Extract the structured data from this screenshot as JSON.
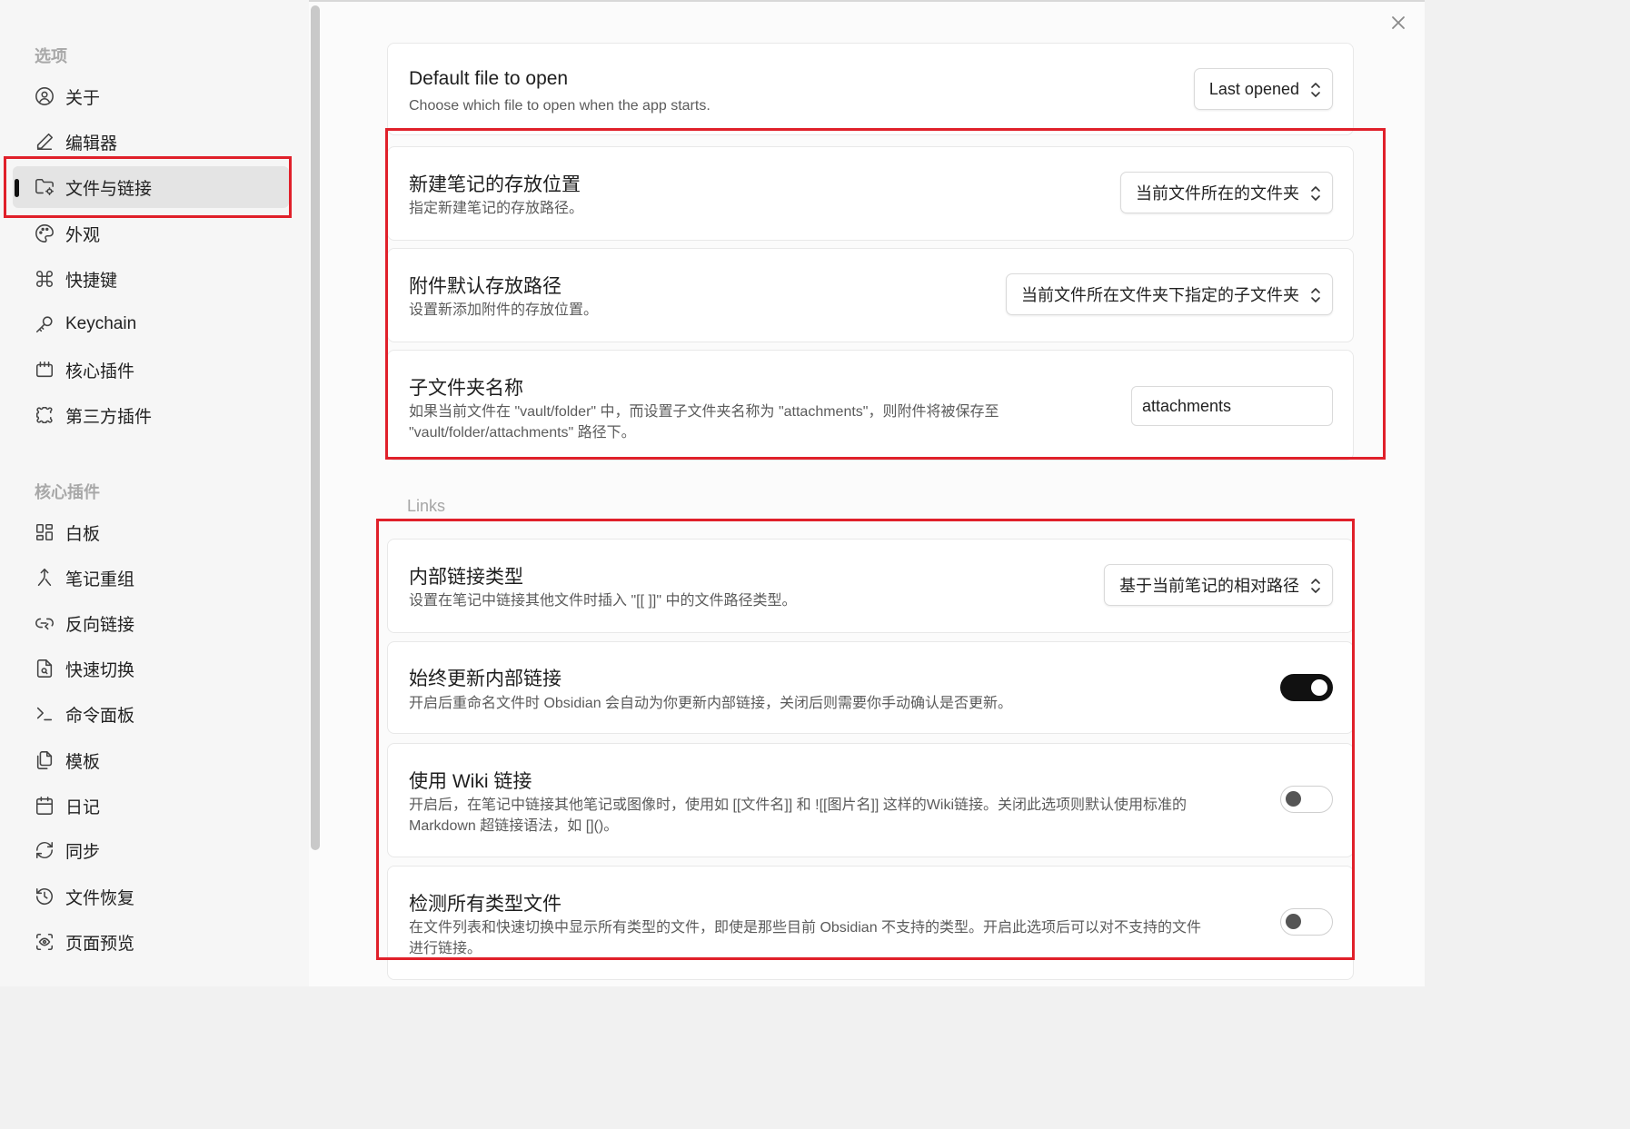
{
  "sidebar": {
    "options_heading": "选项",
    "options_items": [
      {
        "label": "关于",
        "icon": "user-circle-icon"
      },
      {
        "label": "编辑器",
        "icon": "pencil-icon"
      },
      {
        "label": "文件与链接",
        "icon": "folder-cog-icon",
        "active": true
      },
      {
        "label": "外观",
        "icon": "palette-icon"
      },
      {
        "label": "快捷键",
        "icon": "command-icon"
      },
      {
        "label": "Keychain",
        "icon": "key-icon"
      },
      {
        "label": "核心插件",
        "icon": "calendar-box-icon"
      },
      {
        "label": "第三方插件",
        "icon": "puzzle-icon"
      }
    ],
    "core_heading": "核心插件",
    "core_items": [
      {
        "label": "白板",
        "icon": "layout-dashboard-icon"
      },
      {
        "label": "笔记重组",
        "icon": "merge-arrow-icon"
      },
      {
        "label": "反向链接",
        "icon": "backlink-icon"
      },
      {
        "label": "快速切换",
        "icon": "file-search-icon"
      },
      {
        "label": "命令面板",
        "icon": "terminal-icon"
      },
      {
        "label": "模板",
        "icon": "files-icon"
      },
      {
        "label": "日记",
        "icon": "calendar-icon"
      },
      {
        "label": "同步",
        "icon": "refresh-icon"
      },
      {
        "label": "文件恢复",
        "icon": "history-icon"
      },
      {
        "label": "页面预览",
        "icon": "scan-eye-icon"
      }
    ]
  },
  "settings": {
    "default_file": {
      "title": "Default file to open",
      "desc": "Choose which file to open when the app starts.",
      "value": "Last opened"
    },
    "new_note_location": {
      "title": "新建笔记的存放位置",
      "desc": "指定新建笔记的存放路径。",
      "value": "当前文件所在的文件夹"
    },
    "attachment_location": {
      "title": "附件默认存放路径",
      "desc": "设置新添加附件的存放位置。",
      "value": "当前文件所在文件夹下指定的子文件夹"
    },
    "subfolder_name": {
      "title": "子文件夹名称",
      "desc_line1": "如果当前文件在 \"vault/folder\" 中，而设置子文件夹名称为 \"attachments\"，则附件将被保存至",
      "desc_line2": "\"vault/folder/attachments\" 路径下。",
      "value": "attachments"
    },
    "links_heading": "Links",
    "link_format": {
      "title": "内部链接类型",
      "desc": "设置在笔记中链接其他文件时插入 \"[[ ]]\" 中的文件路径类型。",
      "value": "基于当前笔记的相对路径"
    },
    "auto_update_links": {
      "title": "始终更新内部链接",
      "desc": "开启后重命名文件时 Obsidian 会自动为你更新内部链接，关闭后则需要你手动确认是否更新。",
      "enabled": true
    },
    "wiki_links": {
      "title": "使用 Wiki 链接",
      "desc_line1": "开启后，在笔记中链接其他笔记或图像时，使用如 [[文件名]] 和 ![[图片名]] 这样的Wiki链接。关闭此选项则默认使用标准的",
      "desc_line2": "Markdown 超链接语法，如 []()。",
      "enabled": false
    },
    "detect_all_files": {
      "title": "检测所有类型文件",
      "desc_line1": "在文件列表和快速切换中显示所有类型的文件，即使是那些目前 Obsidian 不支持的类型。开启此选项后可以对不支持的文件",
      "desc_line2": "进行链接。",
      "enabled": false
    }
  },
  "colors": {
    "highlight": "#e0202a",
    "toggle_on": "#111111"
  }
}
